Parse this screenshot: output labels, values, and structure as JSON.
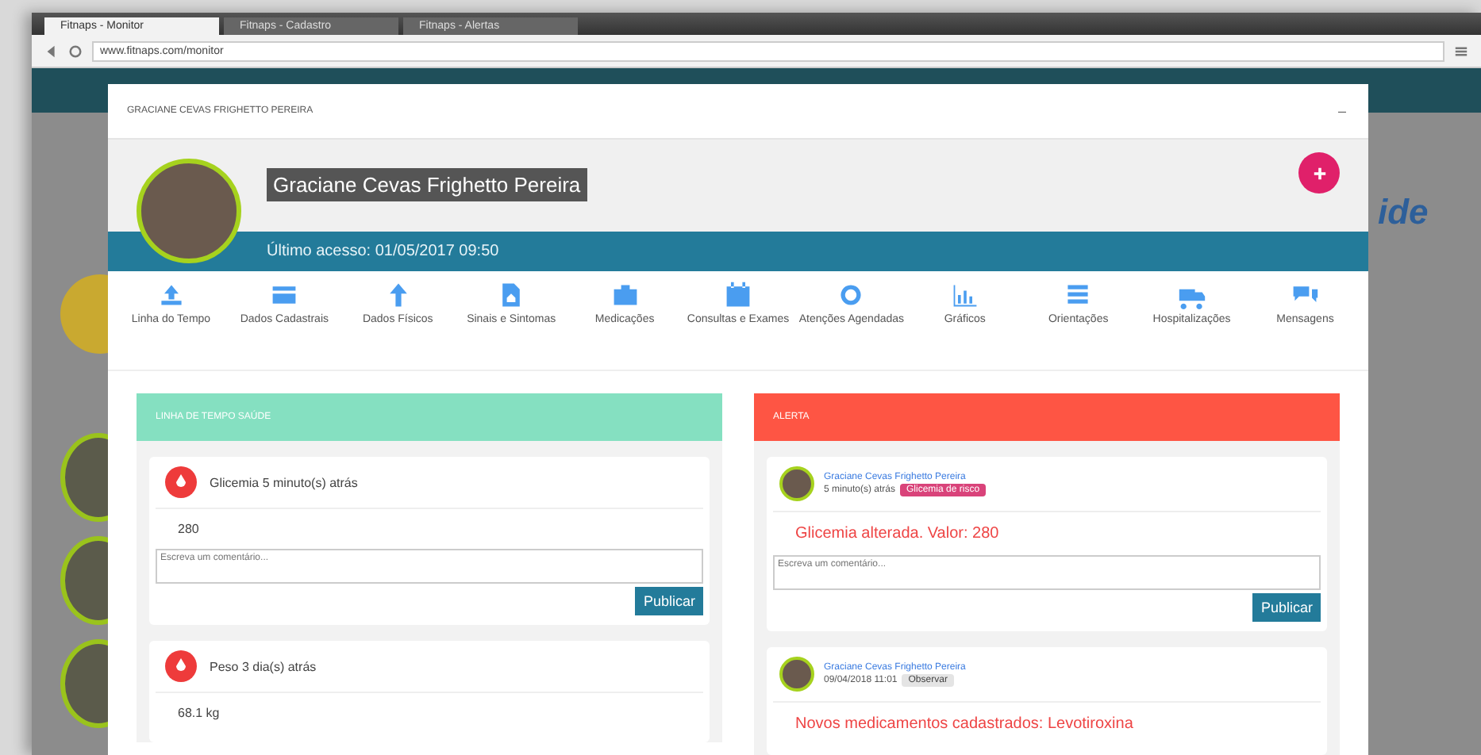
{
  "browser": {
    "tabs": [
      {
        "title": "Fitnaps - Monitor",
        "selected": true
      },
      {
        "title": "Fitnaps - Cadastro",
        "selected": false
      },
      {
        "title": "Fitnaps - Alertas",
        "selected": false
      }
    ],
    "url": "www.fitnaps.com/monitor"
  },
  "backdrop": {
    "logo_text": "ide"
  },
  "modal": {
    "title": "GRACIANE CEVAS FRIGHETTO PEREIRA",
    "close": "–",
    "patient_name": "Graciane Cevas Frighetto Pereira",
    "last_access": "Último acesso: 01/05/2017 09:50",
    "toolbar": [
      {
        "label": "Linha do Tempo"
      },
      {
        "label": "Dados Cadastrais"
      },
      {
        "label": "Dados Físicos"
      },
      {
        "label": "Sinais e Sintomas"
      },
      {
        "label": "Medicações"
      },
      {
        "label": "Consultas e Exames"
      },
      {
        "label": "Atenções Agendadas"
      },
      {
        "label": "Gráficos"
      },
      {
        "label": "Orientações"
      },
      {
        "label": "Hospitalizações"
      },
      {
        "label": "Mensagens"
      }
    ],
    "timeline": {
      "title": "LINHA DE TEMPO SAÚDE",
      "entries": [
        {
          "title": "Glicemia 5 minuto(s) atrás",
          "value": "280",
          "placeholder": "Escreva um comentário...",
          "button": "Publicar"
        },
        {
          "title": "Peso 3 dia(s) atrás",
          "value": "68.1 kg"
        }
      ]
    },
    "alerts": {
      "title": "ALERTA",
      "entries": [
        {
          "author": "Graciane Cevas Frighetto Pereira",
          "time": "5 minuto(s) atrás",
          "badge": {
            "label": "Glicemia de risco",
            "color": "#d9437a"
          },
          "message": "Glicemia alterada. Valor: 280",
          "placeholder": "Escreva um comentário...",
          "button": "Publicar"
        },
        {
          "author": "Graciane Cevas Frighetto Pereira",
          "time": "09/04/2018 11:01",
          "badge": {
            "label": "Observar",
            "color": "#e4e4e4"
          },
          "message": "Novos medicamentos cadastrados: Levotiroxina"
        }
      ]
    }
  }
}
